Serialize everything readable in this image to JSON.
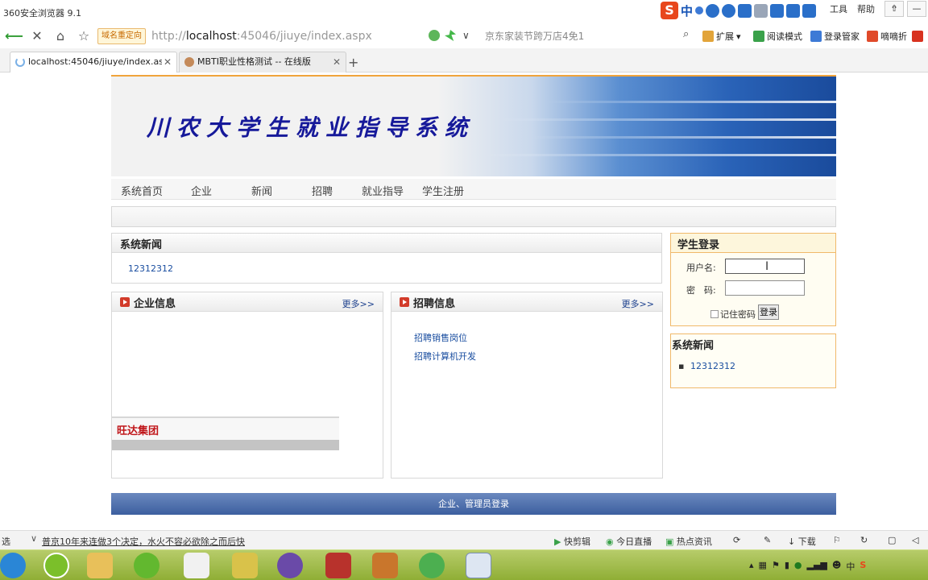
{
  "browser": {
    "title": "360安全浏览器 9.1",
    "menu_tools": "工具",
    "menu_help": "帮助",
    "ime_label": "中",
    "address_badge": "域名重定向",
    "address_prefix": "http://",
    "address_host": "localhost",
    "address_rest": ":45046/jiuye/index.aspx",
    "search_text": "京东家装节跨万店4免1",
    "extensions": [
      "扩展",
      "阅读模式",
      "登录管家",
      "嘀嘀折"
    ],
    "tabs": [
      {
        "label": "localhost:45046/jiuye/index.as",
        "state": "loading"
      },
      {
        "label": "MBTI职业性格测试 -- 在线版",
        "state": "loaded"
      }
    ]
  },
  "site": {
    "banner_title": "川农大学生就业指导系统",
    "menu": [
      "系统首页",
      "企业",
      "新闻",
      "招聘",
      "就业指导",
      "学生注册"
    ],
    "system_news": {
      "title": "系统新闻",
      "items": [
        "12312312"
      ]
    },
    "company_info": {
      "title": "企业信息",
      "more": "更多>>",
      "items": [
        "旺达集团"
      ]
    },
    "recruit_info": {
      "title": "招聘信息",
      "more": "更多>>",
      "items": [
        "招聘销售岗位",
        "招聘计算机开发"
      ]
    },
    "login": {
      "title": "学生登录",
      "username_label": "用户名:",
      "password_label": "密　码:",
      "username_value": "",
      "password_value": "",
      "remember_label": "记住密码",
      "login_button": "登录"
    },
    "side_news": {
      "title": "系统新闻",
      "items": [
        "12312312"
      ]
    },
    "footer_link": "企业、管理员登录"
  },
  "statusbar": {
    "left_text": "选",
    "news_text": "普京10年来连做3个决定，水火不容必欲除之而后快",
    "items": [
      "快剪辑",
      "今日直播",
      "热点资讯",
      "下载"
    ]
  },
  "taskbar": {
    "tray_ime": "中"
  }
}
